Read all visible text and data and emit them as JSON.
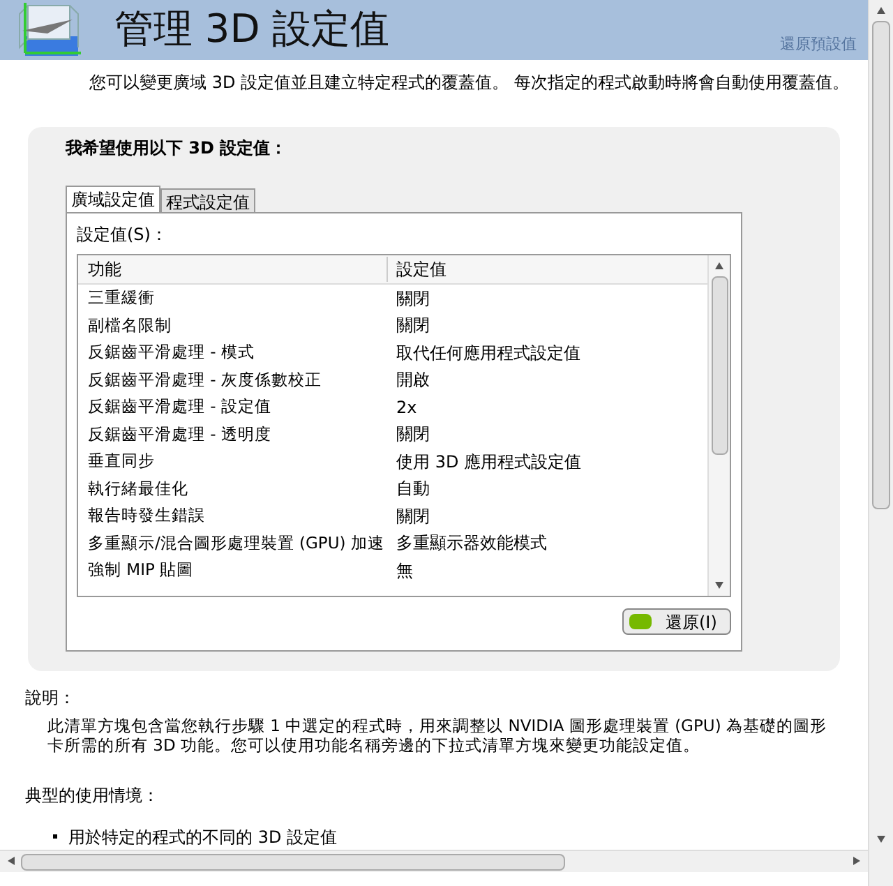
{
  "header": {
    "title": "管理 3D 設定值",
    "restore_defaults": {
      "label": "還原預設值",
      "disabled": true
    }
  },
  "intro": "您可以變更廣域 3D 設定值並且建立特定程式的覆蓋值。 每次指定的程式啟動時將會自動使用覆蓋值。",
  "panel": {
    "heading": "我希望使用以下 3D 設定值：",
    "tabs": [
      {
        "label": "廣域設定值",
        "selected": true
      },
      {
        "label": "程式設定值",
        "selected": false
      }
    ],
    "settings_label": "設定值(S)：",
    "table": {
      "columns": [
        "功能",
        "設定值"
      ],
      "rows": [
        {
          "feature": "三重緩衝",
          "value": "關閉"
        },
        {
          "feature": "副檔名限制",
          "value": "關閉"
        },
        {
          "feature": "反鋸齒平滑處理 - 模式",
          "value": "取代任何應用程式設定值"
        },
        {
          "feature": "反鋸齒平滑處理 - 灰度係數校正",
          "value": "開啟"
        },
        {
          "feature": "反鋸齒平滑處理 - 設定值",
          "value": "2x"
        },
        {
          "feature": "反鋸齒平滑處理 - 透明度",
          "value": "關閉"
        },
        {
          "feature": "垂直同步",
          "value": "使用 3D 應用程式設定值"
        },
        {
          "feature": "執行緒最佳化",
          "value": "自動"
        },
        {
          "feature": "報告時發生錯誤",
          "value": "關閉"
        },
        {
          "feature": "多重顯示/混合圖形處理裝置 (GPU) 加速",
          "value": "多重顯示器效能模式"
        },
        {
          "feature": "強制 MIP 貼圖",
          "value": "無"
        }
      ]
    },
    "restore_button": "還原(I)"
  },
  "description": {
    "label": "說明：",
    "text": "此清單方塊包含當您執行步驟 1 中選定的程式時，用來調整以 NVIDIA 圖形處理裝置 (GPU) 為基礎的圖形卡所需的所有 3D 功能。您可以使用功能名稱旁邊的下拉式清單方塊來變更功能設定值。"
  },
  "usage": {
    "label": "典型的使用情境：",
    "items": [
      "用於特定的程式的不同的 3D 設定值"
    ]
  }
}
